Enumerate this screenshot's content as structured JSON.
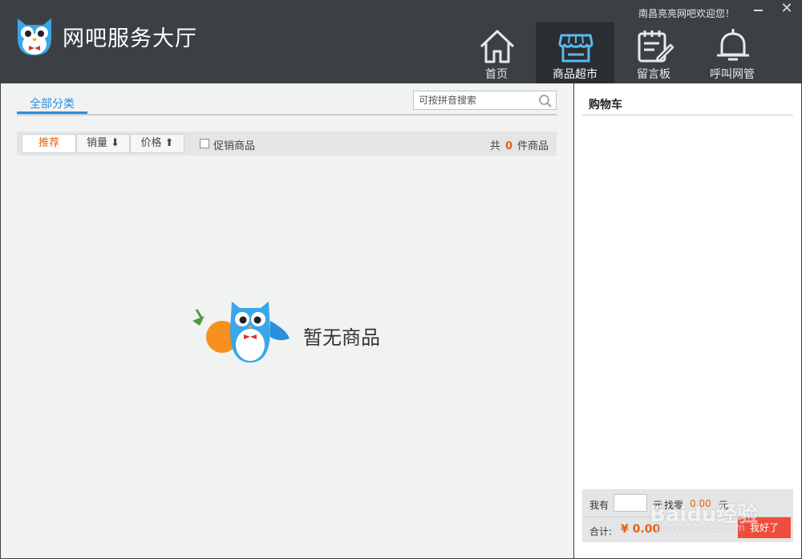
{
  "header": {
    "app_title": "网吧服务大厅",
    "welcome": "南昌亮亮网吧欢迎您！",
    "minimize_label": "",
    "close_label": "✕"
  },
  "nav": [
    {
      "label": "首页",
      "icon": "home-icon"
    },
    {
      "label": "商品超市",
      "icon": "shop-icon",
      "active": true
    },
    {
      "label": "留言板",
      "icon": "message-board-icon"
    },
    {
      "label": "呼叫网管",
      "icon": "bell-icon"
    }
  ],
  "category": {
    "tab_label": "全部分类"
  },
  "search": {
    "placeholder": "可按拼音搜索"
  },
  "filter": {
    "sort_recommend": "推荐",
    "sort_sales": "销量 ⬇",
    "sort_price": "价格 ⬆",
    "promo_label": "促销商品",
    "count_prefix": "共",
    "count_value": "0",
    "count_suffix": "件商品"
  },
  "empty": {
    "message": "暂无商品"
  },
  "cart": {
    "title": "购物车",
    "have_label": "我有",
    "have_unit": "元",
    "change_label": "找零",
    "change_value": "0.00",
    "change_unit": "元",
    "total_label": "合计:",
    "total_value": "¥ 0.00",
    "ok_button": "我好了"
  },
  "watermark": {
    "brand": "Baidu经验",
    "url": "jingyan.baidu.com"
  },
  "colors": {
    "header_bg": "#3c4045",
    "accent_blue": "#2a8fdd",
    "accent_orange": "#e8610f",
    "button_red": "#f04c3b"
  }
}
